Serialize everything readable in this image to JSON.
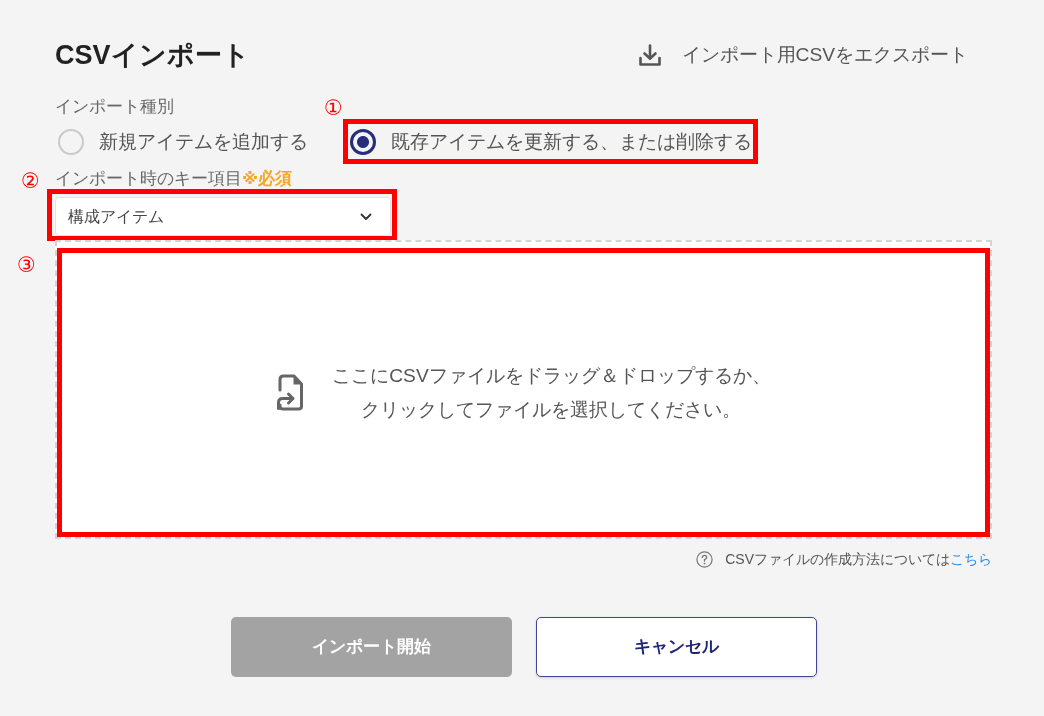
{
  "dialog": {
    "title": "CSVインポート",
    "export_link": {
      "label": "インポート用CSVをエクスポート"
    }
  },
  "import_type": {
    "label": "インポート種別",
    "options": [
      {
        "label": "新規アイテムを追加する",
        "selected": false
      },
      {
        "label": "既存アイテムを更新する、または削除する",
        "selected": true,
        "callout": "①"
      }
    ]
  },
  "key_field": {
    "label": "インポート時のキー項目",
    "required_note": "※必須",
    "value": "構成アイテム",
    "callout": "②"
  },
  "drop_zone": {
    "lines": [
      "ここにCSVファイルをドラッグ＆ドロップするか、",
      "クリックしてファイルを選択してください。"
    ],
    "callout": "③"
  },
  "help": {
    "text": "CSVファイルの作成方法については",
    "link": "こちら"
  },
  "buttons": [
    {
      "label": "インポート開始",
      "kind": "primary",
      "disabled": true
    },
    {
      "label": "キャンセル",
      "kind": "secondary",
      "disabled": false
    }
  ]
}
